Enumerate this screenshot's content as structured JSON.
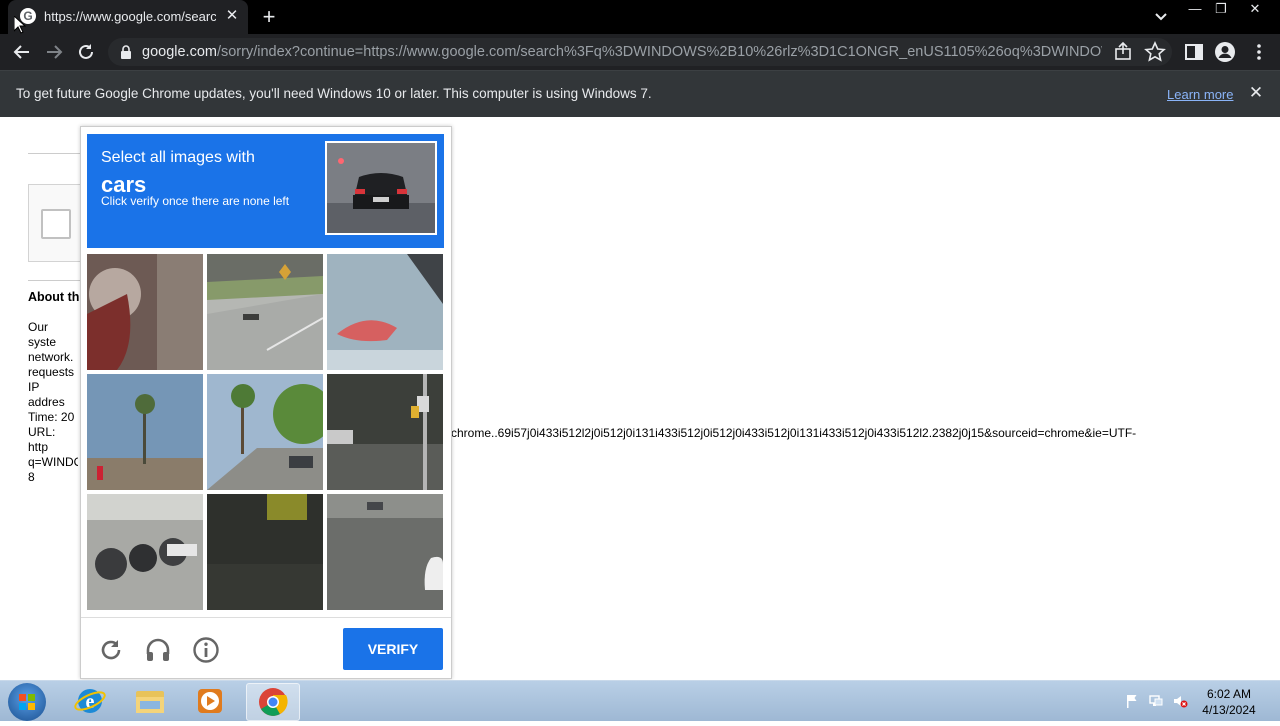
{
  "browser": {
    "tab_title": "https://www.google.com/search?",
    "favicon_letter": "G",
    "address_host": "google.com",
    "address_rest": "/sorry/index?continue=https://www.google.com/search%3Fq%3DWINDOWS%2B10%26rlz%3D1C1ONGR_enUS1105%26oq%3DWINDOWS%2...",
    "icons": [
      "back-icon",
      "forward-icon",
      "reload-icon",
      "lock-icon",
      "share-icon",
      "star-icon",
      "side-panel-icon",
      "profile-icon",
      "menu-icon"
    ]
  },
  "infobar": {
    "message": "To get future Google Chrome updates, you'll need Windows 10 or later. This computer is using Windows 7.",
    "link": "Learn more"
  },
  "page": {
    "about_heading": "About th",
    "para1": "Our syste network. requests",
    "para2": "IP addres Time: 20 URL: http q=WINDO 8",
    "url_tail": "chrome..69i57j0i433i512l2j0i512j0i131i433i512j0i512j0i433i512j0i131i433i512j0i433i512l2.2382j0j15&sourceid=chrome&ie=UTF-"
  },
  "captcha": {
    "instruction": "Select all images with",
    "target": "cars",
    "hint": "Click verify once there are none left",
    "verify_label": "VERIFY",
    "tiles": [
      {
        "name": "tile-1",
        "scene": "fire-hydrant-closeup"
      },
      {
        "name": "tile-2",
        "scene": "road-under-overpass"
      },
      {
        "name": "tile-3",
        "scene": "boat-on-water"
      },
      {
        "name": "tile-4",
        "scene": "palm-trees-sky"
      },
      {
        "name": "tile-5",
        "scene": "street-with-palms"
      },
      {
        "name": "tile-6",
        "scene": "traffic-light-street"
      },
      {
        "name": "tile-7",
        "scene": "parked-motorcycles"
      },
      {
        "name": "tile-8",
        "scene": "dark-street-corner"
      },
      {
        "name": "tile-9",
        "scene": "road-with-car-edge"
      }
    ],
    "footer_icons": [
      "reload-icon",
      "audio-headphones-icon",
      "info-icon"
    ]
  },
  "taskbar": {
    "apps": [
      "internet-explorer-icon",
      "file-explorer-icon",
      "media-player-icon",
      "chrome-icon"
    ],
    "clock_time": "6:02 AM",
    "clock_date": "4/13/2024"
  }
}
